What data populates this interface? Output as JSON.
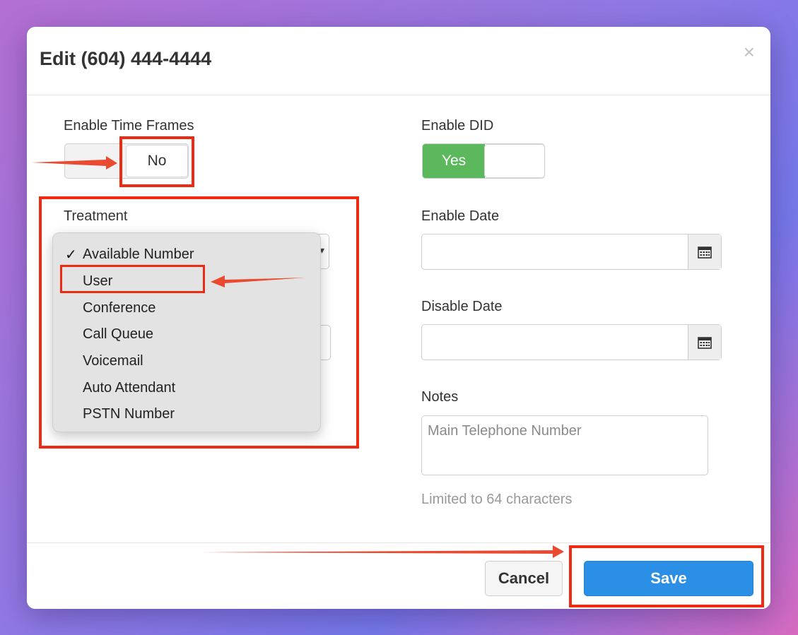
{
  "modal": {
    "title": "Edit (604) 444-4444",
    "close_icon": "close-icon",
    "close_glyph": "×"
  },
  "left": {
    "time_frames_label": "Enable Time Frames",
    "time_frames_value": "No",
    "treatment_label": "Treatment",
    "treatment_options": [
      {
        "label": "Available Number",
        "selected": true
      },
      {
        "label": "User",
        "selected": false
      },
      {
        "label": "Conference",
        "selected": false
      },
      {
        "label": "Call Queue",
        "selected": false
      },
      {
        "label": "Voicemail",
        "selected": false
      },
      {
        "label": "Auto Attendant",
        "selected": false
      },
      {
        "label": "PSTN Number",
        "selected": false
      }
    ],
    "check_glyph": "✓"
  },
  "right": {
    "enable_did_label": "Enable DID",
    "enable_did_value": "Yes",
    "enable_date_label": "Enable Date",
    "enable_date_value": "",
    "disable_date_label": "Disable Date",
    "disable_date_value": "",
    "notes_label": "Notes",
    "notes_value": "Main Telephone Number",
    "notes_help": "Limited to 64 characters"
  },
  "footer": {
    "cancel_label": "Cancel",
    "save_label": "Save"
  },
  "colors": {
    "accent": "#2b8fe6",
    "toggle_on": "#5cb85c",
    "annotation": "#ee2a12"
  }
}
